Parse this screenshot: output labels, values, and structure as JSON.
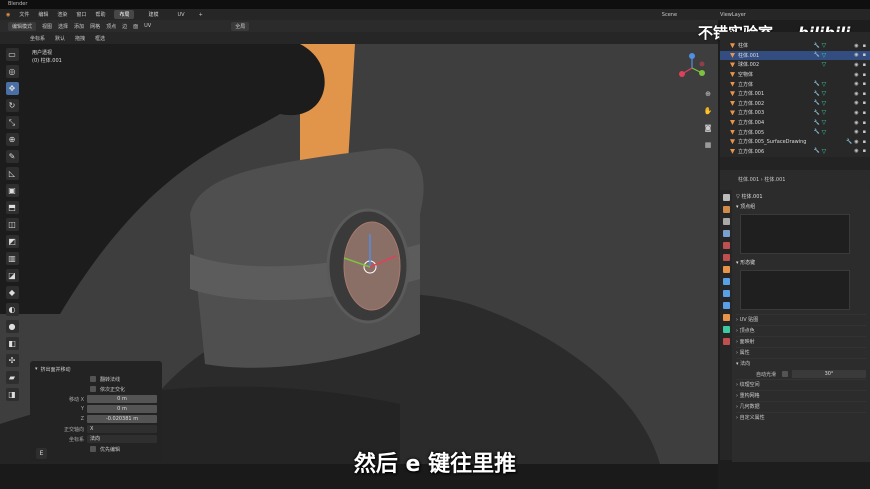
{
  "app": {
    "title": "Blender"
  },
  "menu": {
    "items": [
      "文件",
      "编辑",
      "渲染",
      "窗口",
      "帮助"
    ],
    "workspaces": [
      "布局",
      "建模",
      "UV"
    ],
    "active_ws": "布局",
    "scene": "Scene",
    "viewlayer": "ViewLayer"
  },
  "header": {
    "mode": "编辑模式",
    "global": "全局",
    "view": "视图",
    "select": "选择",
    "add": "添加",
    "mesh": "网格",
    "vertex": "顶点",
    "edge": "边",
    "face": "面",
    "uv": "UV"
  },
  "toolbar2": {
    "orient_label": "坐标系",
    "orient_value": "默认",
    "drag_label": "拖拽",
    "drag_value": "框选"
  },
  "viewport": {
    "view_name": "用户透视",
    "object_info": "(0) 柱体.001",
    "outline_color": "#4a4a4a",
    "sky_color": "#e0954a"
  },
  "op_panel": {
    "title": "挤出面并移动",
    "cb1": "翻转法线",
    "cb2": "依次正交化",
    "move_label": "移动",
    "x_label": "X",
    "y_label": "Y",
    "z_label": "Z",
    "x_val": "0 m",
    "y_val": "0 m",
    "z_val": "-0.020381 m",
    "orient_label": "正交轴向",
    "orient_val": "X",
    "coord_label": "坐标系",
    "coord_val": "法向",
    "cb3": "优先编辑"
  },
  "subtitle": "然后 e 键往里推",
  "watermark": {
    "brand": "不错实验室",
    "site": "bilibili"
  },
  "outliner": {
    "items": [
      "柱体",
      "柱体.001",
      "球体.002",
      "空物体",
      "立方体",
      "立方体.001",
      "立方体.002",
      "立方体.003",
      "立方体.004",
      "立方体.005",
      "立方体.005_SurfaceDrawing",
      "立方体.006"
    ],
    "selected": 1
  },
  "props": {
    "crumb1": "柱体.001",
    "crumb2": "柱体.001",
    "mesh_name": "柱体.001",
    "sec_vgroups": "顶点组",
    "sec_shapekeys": "形态键",
    "sec_uv": "UV 贴图",
    "sec_vcol": "顶点色",
    "sec_facemaps": "面映射",
    "sec_attrs": "属性",
    "sec_normals": "法向",
    "auto_smooth": "自动光滑",
    "angle": "30°",
    "sec_texspace": "纹理空间",
    "sec_remesh": "重构网格",
    "sec_geom": "几何数据",
    "sec_custom": "自定义属性"
  }
}
